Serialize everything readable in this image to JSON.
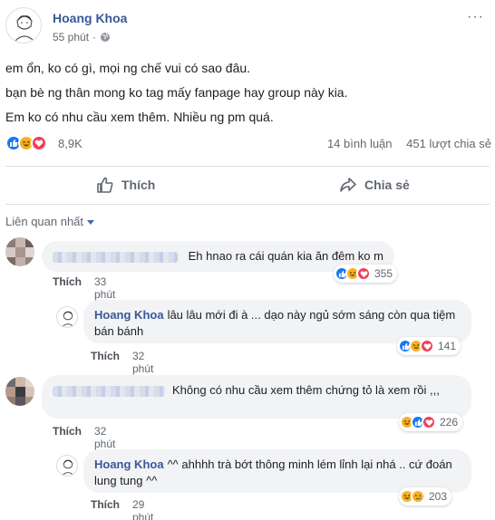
{
  "post": {
    "author": "Hoang Khoa",
    "time": "55 phút",
    "more_icon": "···",
    "lines": [
      "em ổn, ko có gì, mọi ng chế vui có sao đâu.",
      "bạn bè ng thân mong ko tag mấy fanpage hay group này kia.",
      "Em ko có nhu cầu xem thêm. Nhiều ng pm quá."
    ],
    "reactions_count": "8,9K",
    "comments_count": "14 bình luận",
    "shares_count": "451 lượt chia sẻ"
  },
  "actions": {
    "like_label": "Thích",
    "share_label": "Chia sẻ"
  },
  "sort_label": "Liên quan nhất",
  "comments": [
    {
      "text": "Eh hnao ra cái quán kia ăn đêm ko m",
      "like_label": "Thích",
      "time": "33 phút",
      "reaction_count": "355"
    },
    {
      "author": "Hoang Khoa",
      "text": "lâu lâu mới đi à ... dạo này ngủ sớm sáng còn qua tiệm bán bánh",
      "like_label": "Thích",
      "time": "32 phút",
      "reaction_count": "141"
    },
    {
      "text": "Không có nhu cầu xem thêm chứng tỏ là xem rồi ,,,",
      "like_label": "Thích",
      "time": "32 phút",
      "reaction_count": "226"
    },
    {
      "author": "Hoang Khoa",
      "text": "^^ ahhhh trà bớt thông minh lém lỉnh lại nhá .. cứ đoán lung tung ^^",
      "like_label": "Thích",
      "time": "29 phút",
      "reaction_count": "203"
    }
  ],
  "colors": {
    "link": "#385898",
    "like": "#1877f2",
    "haha": "#f7b125",
    "love": "#f33e58",
    "bubble": "#f2f3f5"
  }
}
